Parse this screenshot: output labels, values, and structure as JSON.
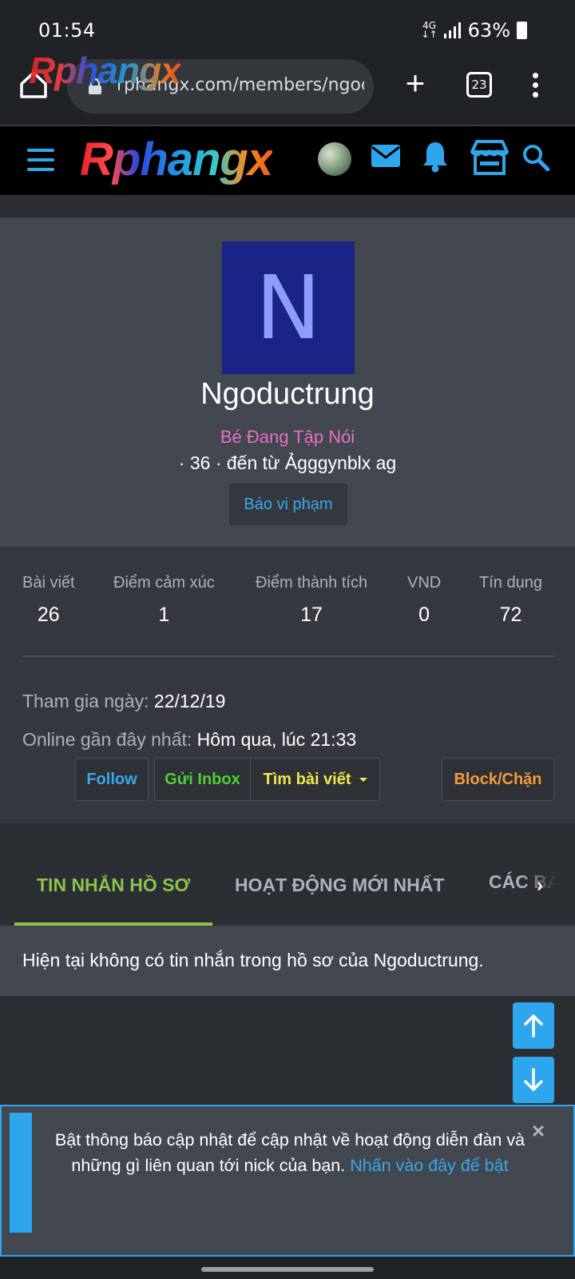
{
  "status_bar": {
    "time": "01:54",
    "network_top": "4G",
    "network_bottom": "↓↑",
    "battery": "63%"
  },
  "browser": {
    "url": "rphangx.com/members/ngoduc",
    "overlay_logo_text": "Rphangx",
    "tab_count": "23"
  },
  "site": {
    "logo_text": "Rphangx"
  },
  "profile": {
    "avatar_letter": "N",
    "username": "Ngoductrung",
    "user_title": "Bé Đang Tập Nói",
    "from_line": "· 36 · đến từ Ảgggynblx ag",
    "report_label": "Báo vi phạm"
  },
  "stats": [
    {
      "label": "Bài viết",
      "value": "26"
    },
    {
      "label": "Điểm cảm xúc",
      "value": "1"
    },
    {
      "label": "Điểm thành tích",
      "value": "17"
    },
    {
      "label": "VND",
      "value": "0"
    },
    {
      "label": "Tín dụng",
      "value": "72"
    }
  ],
  "info": {
    "joined_label": "Tham gia ngày:",
    "joined_value": "22/12/19",
    "online_label": "Online gần đây nhất:",
    "online_value": "Hôm qua, lúc 21:33"
  },
  "actions": {
    "follow": "Follow",
    "inbox": "Gửi Inbox",
    "find_posts": "Tìm bài viết",
    "block": "Block/Chặn"
  },
  "tabs": [
    {
      "label": "TIN NHẮN HỒ SƠ"
    },
    {
      "label": "HOẠT ĐỘNG MỚI NHẤT"
    },
    {
      "label": "CÁC BÀI VIẾT"
    }
  ],
  "tab_next": "›",
  "profile_message": "Hiện tại không có tin nhắn trong hồ sơ của Ngoductrung.",
  "notification": {
    "text": "Bật thông báo cập nhật để cập nhật về hoạt động diễn đàn và những gì liên quan tới nick của bạn.",
    "link": "Nhấn vào đây để bật",
    "close": "×"
  },
  "colors": {
    "accent_blue": "#2ea6ee",
    "title_pink": "#e96fc8",
    "follow_blue": "#3aa7ee",
    "inbox_green": "#4cd137",
    "find_yellow": "#f2e84a",
    "block_orange": "#f39c3c",
    "tab_active_green": "#8bc34a"
  }
}
